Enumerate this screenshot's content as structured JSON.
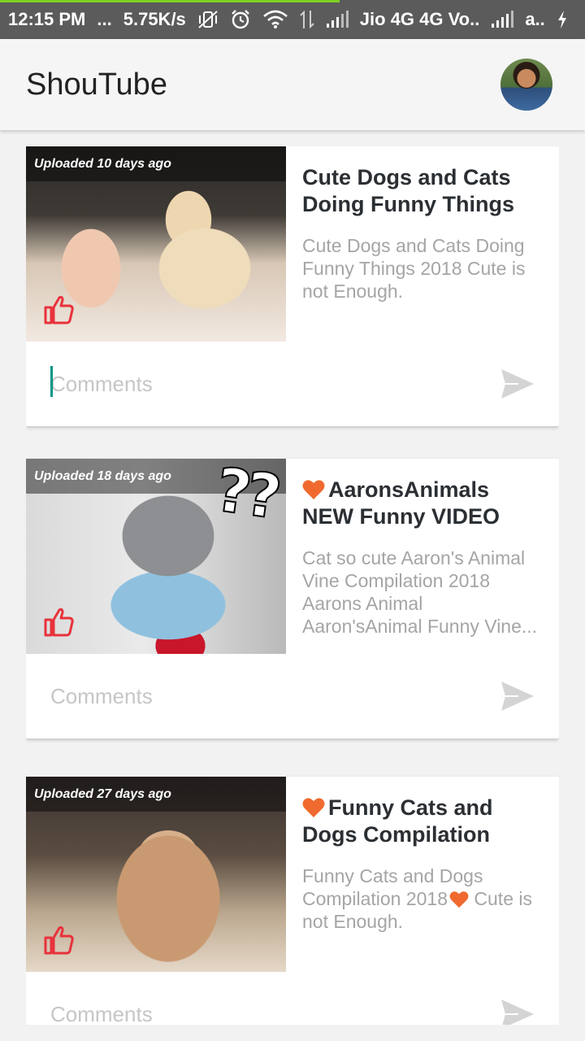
{
  "status_bar": {
    "time": "12:15 PM",
    "dots": "...",
    "net_speed": "5.75K/s",
    "carrier": "Jio 4G 4G Vo..",
    "carrier2": "a..",
    "download_progress": 0.58,
    "icons": [
      "vibrate-off-icon",
      "alarm-icon",
      "wifi-icon",
      "data-transfer-icon",
      "signal-icon",
      "signal-icon",
      "charging-icon"
    ]
  },
  "app_bar": {
    "title": "ShouTube",
    "avatar": "profile-avatar"
  },
  "colors": {
    "heart": "#f06a30",
    "like": "#e8323c",
    "cursor": "#009688",
    "send": "#d4d4d4"
  },
  "videos": [
    {
      "uploaded": "Uploaded 10 days ago",
      "title": "Cute Dogs and Cats Doing Funny Things",
      "has_heart": false,
      "description": "Cute Dogs and Cats Doing Funny Things 2018 Cute is not Enough.",
      "comment_placeholder": "Comments",
      "comment_focused": true
    },
    {
      "uploaded": "Uploaded 18 days ago",
      "title": "AaronsAnimals NEW Funny VIDEO",
      "has_heart": true,
      "description": "Cat so cute Aaron's Animal Vine Compilation 2018 Aarons Animal Aaron'sAnimal Funny Vine...",
      "comment_placeholder": "Comments",
      "overlay_text": "??"
    },
    {
      "uploaded": "Uploaded 27 days ago",
      "title": "Funny Cats and Dogs Compilation",
      "has_heart": true,
      "description_a": "Funny Cats and Dogs Compilation 2018",
      "description_b": " Cute is not Enough.",
      "comment_placeholder": "Comments"
    }
  ]
}
